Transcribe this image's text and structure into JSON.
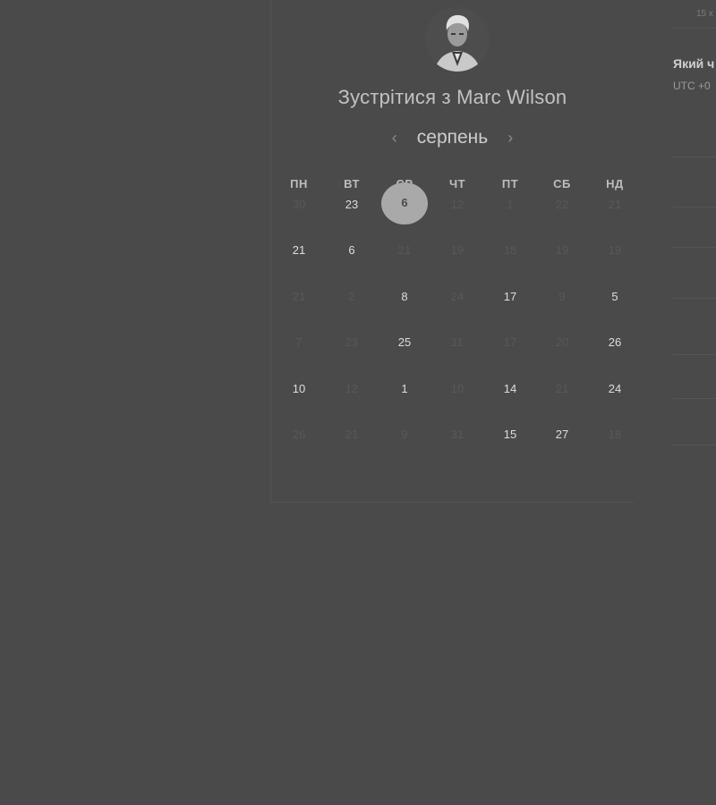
{
  "scheduler": {
    "title": "Зустрітися з Marc Wilson",
    "month": "серпень",
    "prev_arrow": "‹",
    "next_arrow": "›",
    "weekdays": [
      "ПН",
      "ВТ",
      "СР",
      "ЧТ",
      "ПТ",
      "СБ",
      "НД"
    ],
    "selected_day": "6",
    "rows": [
      [
        "30",
        "23",
        "6",
        "12",
        "1",
        "22",
        "21"
      ],
      [
        "21",
        "6",
        "21",
        "19",
        "18",
        "19",
        "19"
      ],
      [
        "21",
        "2",
        "8",
        "24",
        "17",
        "9",
        "5"
      ],
      [
        "7",
        "23",
        "25",
        "11",
        "17",
        "20",
        "26"
      ],
      [
        "10",
        "12",
        "1",
        "10",
        "14",
        "21",
        "24"
      ],
      [
        "26",
        "21",
        "9",
        "31",
        "15",
        "27",
        "18"
      ]
    ],
    "active": [
      [
        false,
        true,
        true,
        false,
        false,
        false,
        false
      ],
      [
        true,
        true,
        false,
        false,
        false,
        false,
        false
      ],
      [
        false,
        false,
        true,
        false,
        true,
        false,
        true
      ],
      [
        false,
        false,
        true,
        false,
        false,
        false,
        true
      ],
      [
        true,
        false,
        true,
        false,
        true,
        false,
        true
      ],
      [
        false,
        false,
        false,
        false,
        true,
        true,
        false
      ]
    ]
  },
  "side": {
    "top_text": "15 х",
    "question": "Який ч",
    "timezone": "UTC +0"
  }
}
